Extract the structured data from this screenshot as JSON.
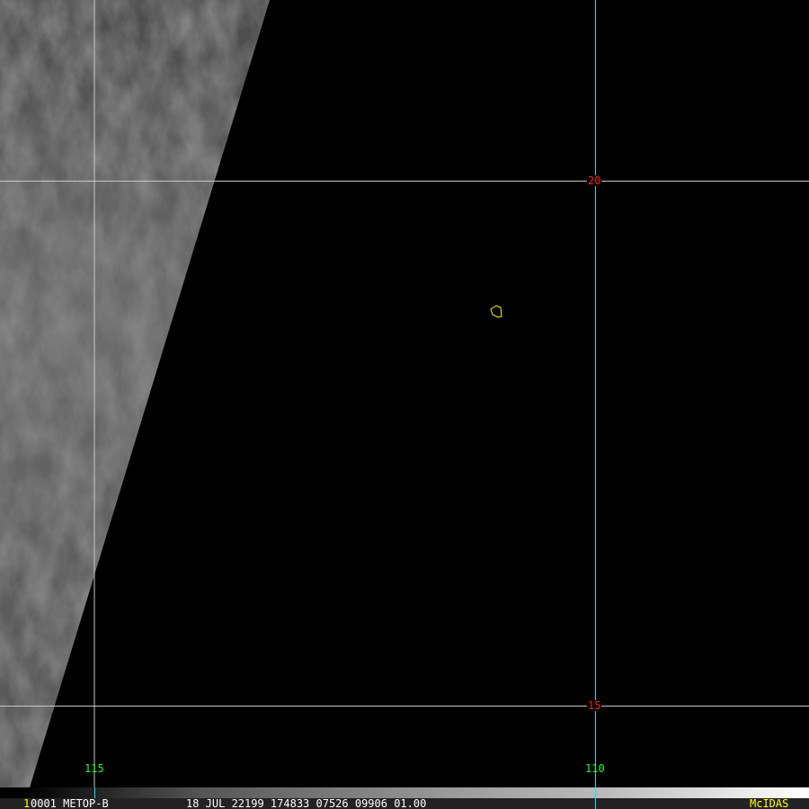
{
  "grid": {
    "lat_labels": [
      "20",
      "15"
    ],
    "lon_labels": [
      "115",
      "110"
    ]
  },
  "colors": {
    "lat_label": "#ff2020",
    "lon_label": "#20ff20",
    "meridian_highlight": "#00e5ff",
    "grid": "#c8c8c8",
    "marker": "#ffff00"
  },
  "status_bar": {
    "frame_number": "1",
    "image_id": "0001 METOP-B",
    "datetime_info": "18 JUL 22199 174833 07526 09906 01.00",
    "brand": "McIDAS"
  }
}
